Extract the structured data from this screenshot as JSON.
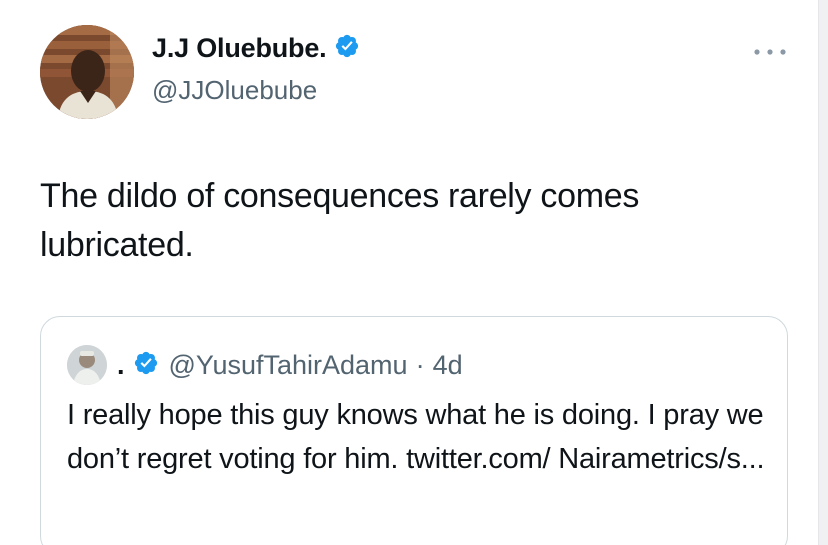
{
  "tweet": {
    "author": {
      "display_name": "J.J Oluebube.",
      "handle": "@JJOluebube",
      "verified": true,
      "avatar_icon": "profile-photo"
    },
    "more_icon": "more-horizontal-icon",
    "text": "The dildo of consequences rarely comes lubricated."
  },
  "quoted_tweet": {
    "author": {
      "display_name": ".",
      "handle": "@YusufTahirAdamu",
      "verified": true,
      "avatar_icon": "profile-photo"
    },
    "separator": "·",
    "time": "4d",
    "text": "I really hope this guy knows what he is doing. I pray we don’t regret voting for him. twitter.com/ Nairametrics/s..."
  },
  "colors": {
    "text": "#0f1419",
    "secondary": "#536471",
    "verified_badge": "#1d9bf0",
    "border": "#cfd9de"
  }
}
